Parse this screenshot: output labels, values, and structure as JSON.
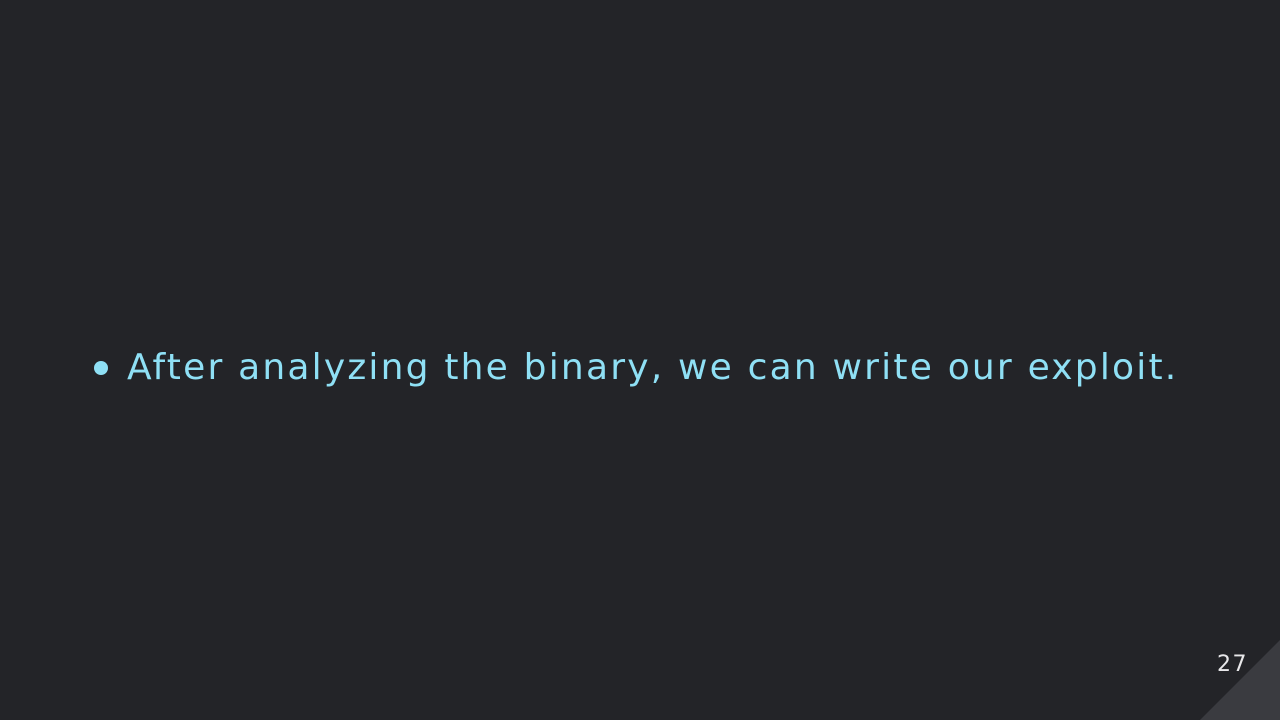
{
  "slide": {
    "bullets": [
      {
        "text": "After analyzing the binary, we can write our exploit."
      }
    ],
    "page_number": "27"
  },
  "colors": {
    "background": "#232428",
    "text_accent": "#8fe0f5",
    "corner_shape": "#3a3b40",
    "page_number": "#e8e8ea"
  }
}
